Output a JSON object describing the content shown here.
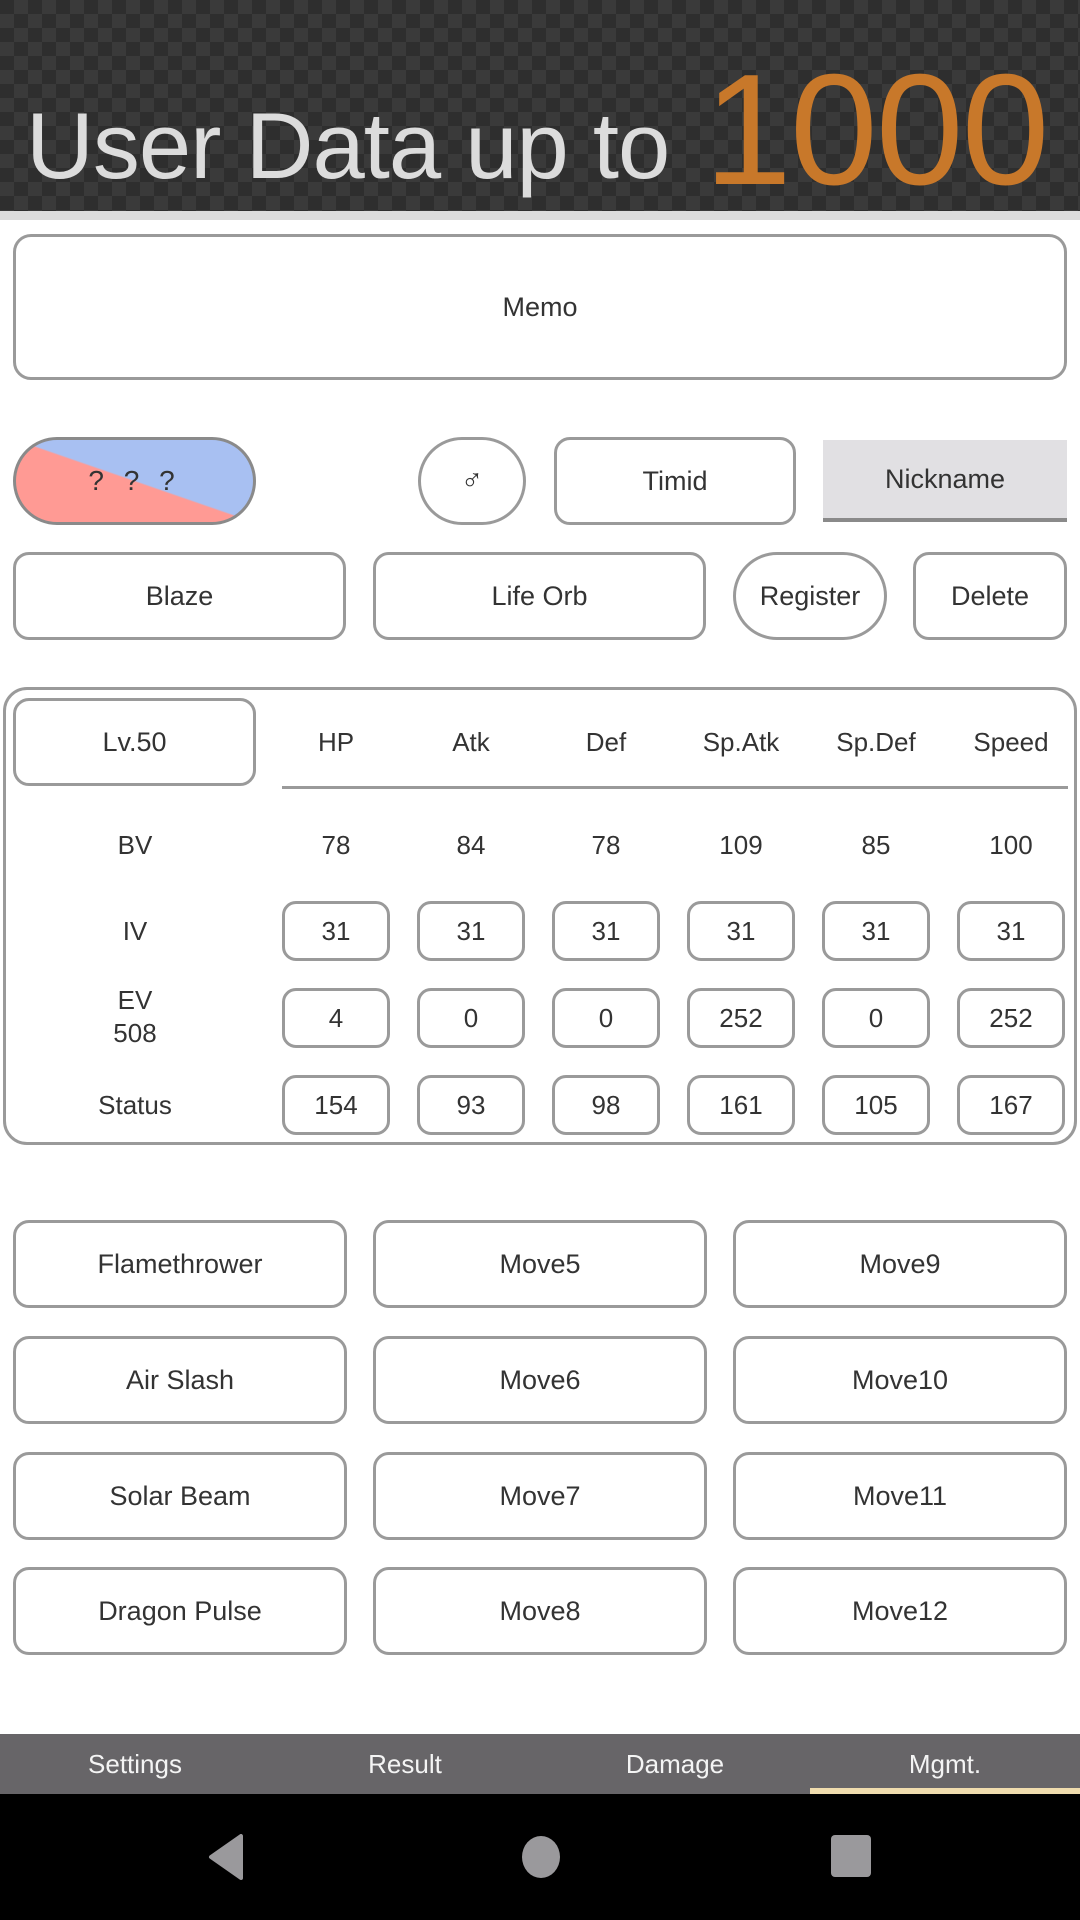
{
  "header": {
    "title": "User Data up to",
    "number": "1000",
    "number_color": "#c8782a"
  },
  "memo": {
    "label": "Memo"
  },
  "pokemon": {
    "type_label": "? ? ?",
    "type_colors": [
      "#ff9a94",
      "#a8c0f2"
    ],
    "gender": "♂",
    "nature": "Timid",
    "nickname_placeholder": "Nickname",
    "ability": "Blaze",
    "item": "Life Orb"
  },
  "actions": {
    "register": "Register",
    "delete": "Delete"
  },
  "stats": {
    "level": "Lv.50",
    "headers": [
      "HP",
      "Atk",
      "Def",
      "Sp.Atk",
      "Sp.Def",
      "Speed"
    ],
    "rows": [
      {
        "label": "BV",
        "values": [
          "78",
          "84",
          "78",
          "109",
          "85",
          "100"
        ]
      },
      {
        "label": "IV",
        "values": [
          "31",
          "31",
          "31",
          "31",
          "31",
          "31"
        ]
      },
      {
        "label": "EV",
        "sublabel": "508",
        "values": [
          "4",
          "0",
          "0",
          "252",
          "0",
          "252"
        ]
      },
      {
        "label": "Status",
        "values": [
          "154",
          "93",
          "98",
          "161",
          "105",
          "167"
        ]
      }
    ]
  },
  "moves": [
    [
      "Flamethrower",
      "Move5",
      "Move9"
    ],
    [
      "Air Slash",
      "Move6",
      "Move10"
    ],
    [
      "Solar Beam",
      "Move7",
      "Move11"
    ],
    [
      "Dragon Pulse",
      "Move8",
      "Move12"
    ]
  ],
  "tabs": [
    {
      "label": "Settings",
      "active": false
    },
    {
      "label": "Result",
      "active": false
    },
    {
      "label": "Damage",
      "active": false
    },
    {
      "label": "Mgmt.",
      "active": true
    }
  ],
  "system_nav": {
    "back": "back-icon",
    "home": "home-icon",
    "recents": "recents-icon"
  }
}
